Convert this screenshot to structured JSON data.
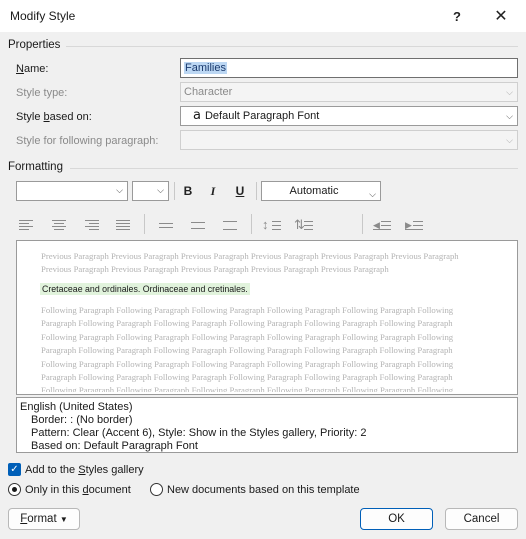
{
  "window": {
    "title": "Modify Style",
    "help_glyph": "?",
    "close_glyph": "✕"
  },
  "properties": {
    "section_label": "Properties",
    "name_label": "Name:",
    "name_value": "Families",
    "style_type_label": "Style type:",
    "style_type_value": "Character",
    "based_on_label": "Style based on:",
    "based_on_glyph": "a",
    "based_on_value": "Default Paragraph Font",
    "following_label": "Style for following paragraph:",
    "following_value": ""
  },
  "formatting": {
    "section_label": "Formatting",
    "font_value": "",
    "size_value": "",
    "bold": "B",
    "italic": "I",
    "underline": "U",
    "color_value": "Automatic"
  },
  "preview": {
    "previous_text": "Previous Paragraph Previous Paragraph Previous Paragraph Previous Paragraph Previous Paragraph Previous Paragraph Previous Paragraph Previous Paragraph Previous Paragraph Previous Paragraph Previous Paragraph",
    "sample_text": "Cretaceae and ordinales. Ordinaceae and cretinales.",
    "following_text": "Following Paragraph Following Paragraph Following Paragraph Following Paragraph Following Paragraph Following Paragraph Following Paragraph Following Paragraph Following Paragraph Following Paragraph Following Paragraph Following Paragraph Following Paragraph Following Paragraph Following Paragraph Following Paragraph Following Paragraph Following Paragraph Following Paragraph Following Paragraph Following Paragraph Following Paragraph Following Paragraph Following Paragraph Following Paragraph Following Paragraph Following Paragraph Following Paragraph Following Paragraph Following Paragraph Following Paragraph Following Paragraph Following Paragraph Following Paragraph Following Paragraph Following Paragraph Following Paragraph Following Paragraph Following Paragraph Following Paragraph"
  },
  "description": {
    "line1": "English (United States)",
    "line2": "Border: : (No border)",
    "line3": "Pattern: Clear (Accent 6), Style: Show in the Styles gallery, Priority: 2",
    "line4": "Based on: Default Paragraph Font"
  },
  "options": {
    "add_to_gallery": "Add to the Styles gallery",
    "add_to_gallery_checked": true,
    "only_this_doc": "Only in this document",
    "new_docs": "New documents based on this template",
    "selected_scope": "only_this_doc"
  },
  "buttons": {
    "format": "Format",
    "ok": "OK",
    "cancel": "Cancel"
  },
  "colors": {
    "accent": "#005fb8",
    "sample_highlight": "#e1f3dc",
    "selection": "#bcd7f3"
  }
}
